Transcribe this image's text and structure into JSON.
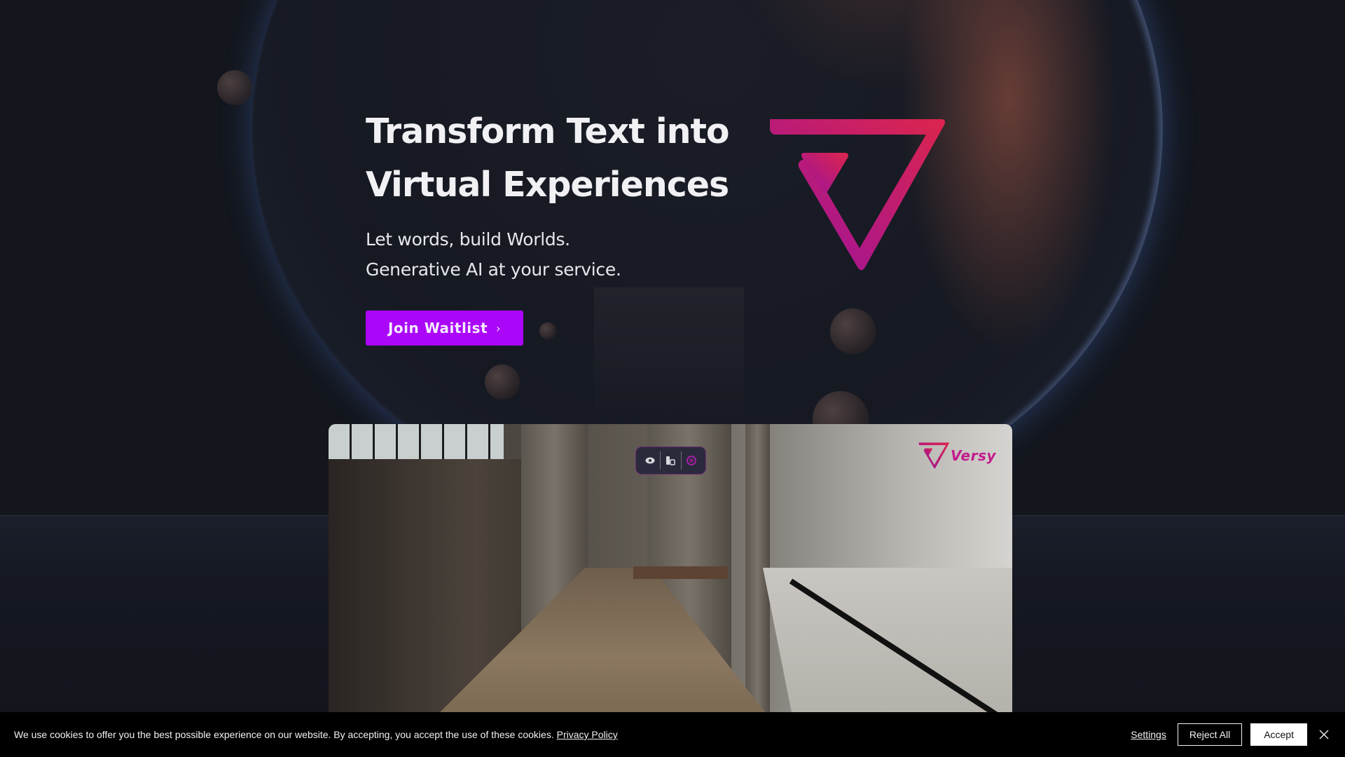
{
  "hero": {
    "title_line1": "Transform Text into",
    "title_line2": "Virtual Experiences",
    "subtitle_line1": "Let words, build Worlds.",
    "subtitle_line2": "Generative AI at your service.",
    "cta_label": "Join Waitlist",
    "cta_icon": "chevron-right-icon",
    "cta_glyph": "›"
  },
  "brand": {
    "name": "Versy",
    "logo_gradient_start": "#a3139a",
    "logo_gradient_end": "#d8254f",
    "accent": "#aa06f8"
  },
  "preview": {
    "toolbar": [
      {
        "icon": "eye-icon",
        "label": "View"
      },
      {
        "icon": "edit-document-icon",
        "label": "Edit"
      },
      {
        "icon": "record-icon",
        "label": "Record"
      }
    ],
    "watermark": "Versy"
  },
  "cookie_banner": {
    "message": "We use cookies to offer you the best possible experience on our website. By accepting, you accept the use of these cookies.",
    "privacy_link": "Privacy Policy",
    "settings_label": "Settings",
    "reject_label": "Reject All",
    "accept_label": "Accept",
    "close_icon": "close-icon"
  }
}
